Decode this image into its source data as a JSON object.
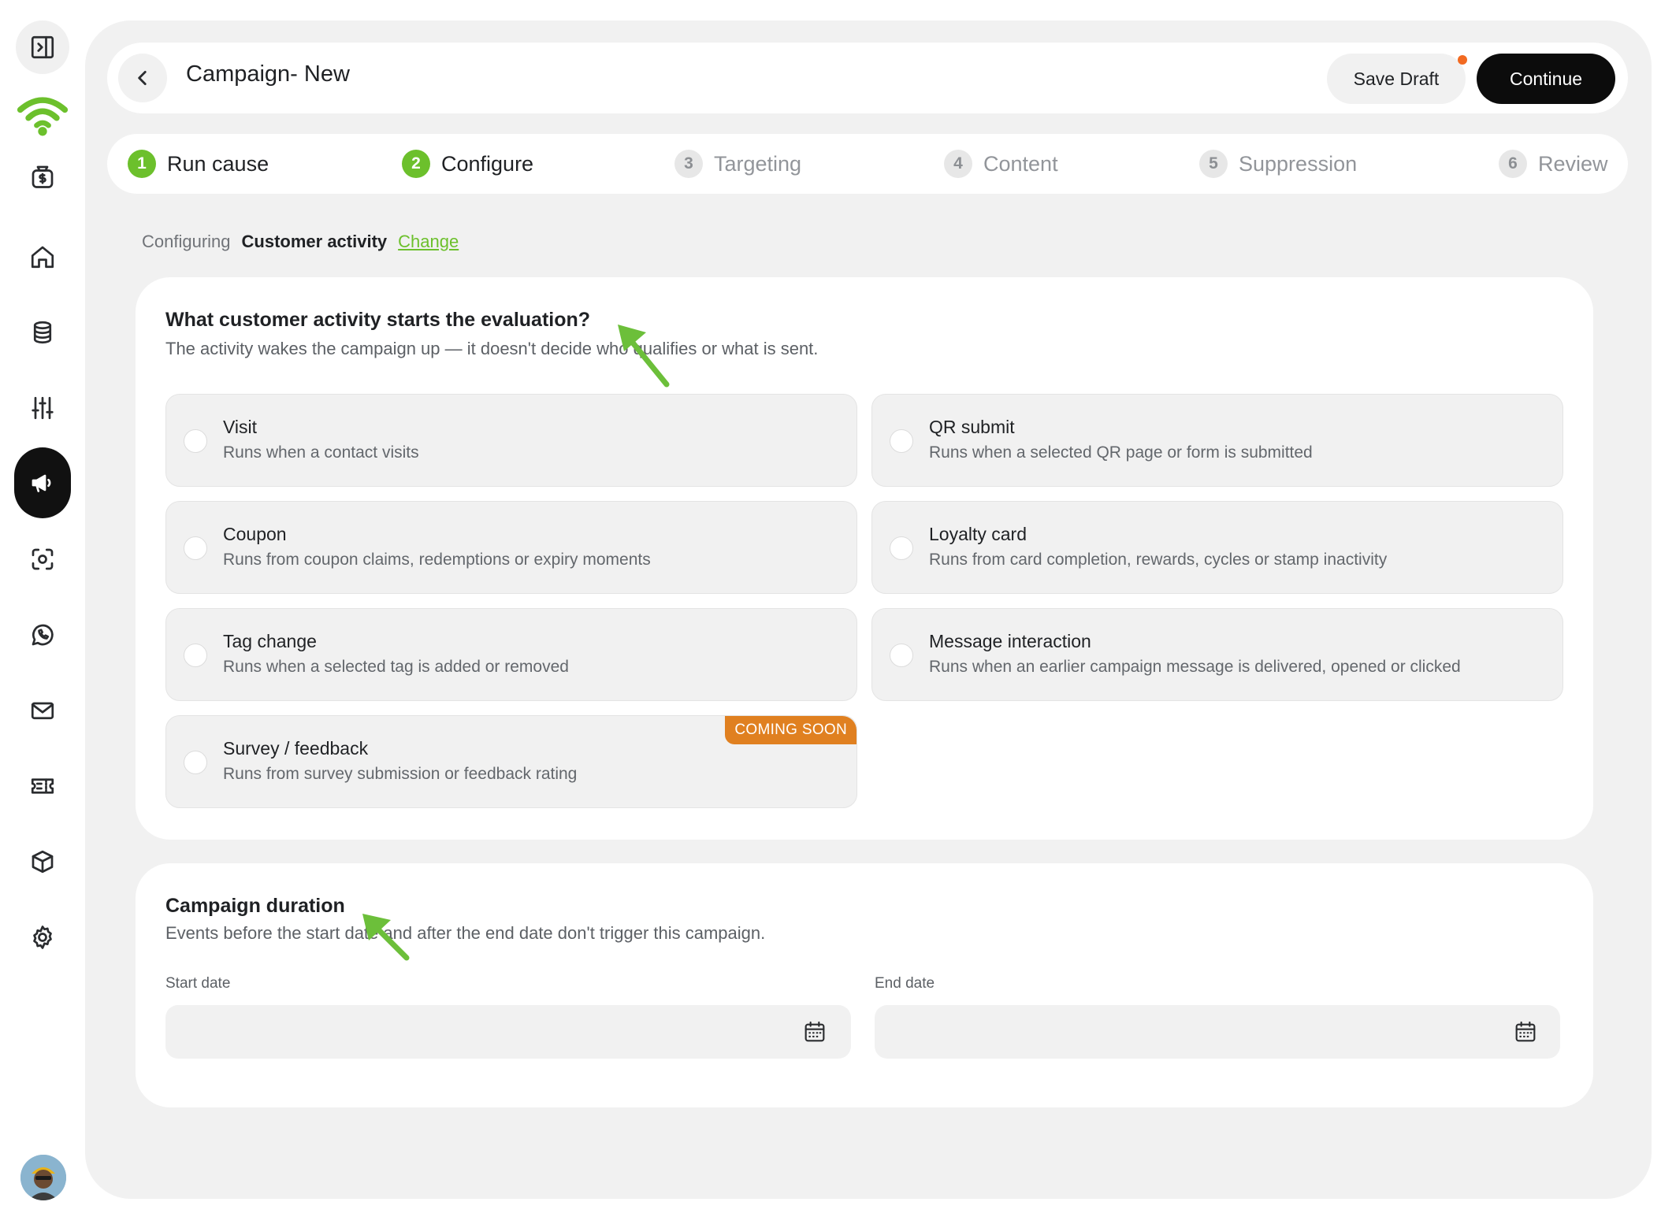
{
  "header": {
    "title": "Campaign- New",
    "save_draft_label": "Save Draft",
    "continue_label": "Continue"
  },
  "stepper": {
    "steps": [
      {
        "number": "1",
        "label": "Run cause",
        "state": "done"
      },
      {
        "number": "2",
        "label": "Configure",
        "state": "done"
      },
      {
        "number": "3",
        "label": "Targeting",
        "state": "todo"
      },
      {
        "number": "4",
        "label": "Content",
        "state": "todo"
      },
      {
        "number": "5",
        "label": "Suppression",
        "state": "todo"
      },
      {
        "number": "6",
        "label": "Review",
        "state": "todo"
      }
    ]
  },
  "config": {
    "prefix": "Configuring",
    "value": "Customer activity",
    "change_label": "Change"
  },
  "activity": {
    "title": "What customer activity starts the evaluation?",
    "subtitle": "The activity wakes the campaign up — it doesn't decide who qualifies or what is sent.",
    "options": [
      {
        "title": "Visit",
        "description": "Runs when a contact visits"
      },
      {
        "title": "QR submit",
        "description": "Runs when a selected QR page or form is submitted"
      },
      {
        "title": "Coupon",
        "description": "Runs from coupon claims, redemptions or expiry moments"
      },
      {
        "title": "Loyalty card",
        "description": "Runs from card completion, rewards, cycles or stamp inactivity"
      },
      {
        "title": "Tag change",
        "description": "Runs when a selected tag is added or removed"
      },
      {
        "title": "Message interaction",
        "description": "Runs when an earlier campaign message is delivered, opened or clicked"
      },
      {
        "title": "Survey / feedback",
        "description": "Runs from survey submission or feedback rating",
        "badge": "COMING SOON"
      }
    ]
  },
  "duration": {
    "title": "Campaign duration",
    "subtitle": "Events before the start date and after the end date don't trigger this campaign.",
    "start_label": "Start date",
    "end_label": "End date",
    "start_value": "",
    "end_value": ""
  },
  "colors": {
    "accent_green": "#6cc02c",
    "badge_orange": "#e08020",
    "draft_dot": "#f26a21",
    "primary_button": "#0c0c0c",
    "annotation_arrow": "#6cbf3a"
  },
  "sidebar": {
    "icons": [
      "panel-toggle-icon",
      "wifi-logo-icon",
      "money-bag-icon",
      "home-icon",
      "database-icon",
      "sliders-icon",
      "megaphone-icon",
      "scan-icon",
      "whatsapp-icon",
      "mail-icon",
      "ticket-icon",
      "box-icon",
      "gear-icon"
    ],
    "active": "megaphone-icon"
  }
}
